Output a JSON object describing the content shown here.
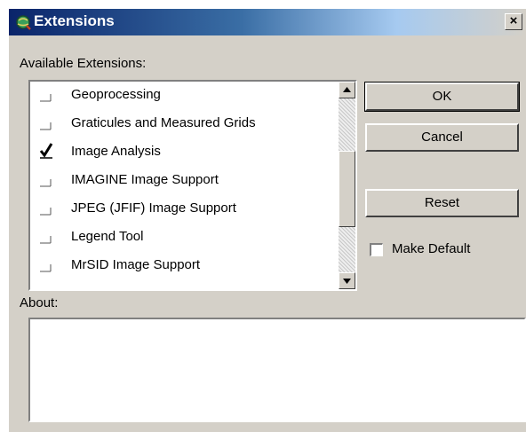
{
  "window": {
    "title": "Extensions",
    "close_glyph": "×"
  },
  "labels": {
    "available": "Available Extensions:",
    "about": "About:"
  },
  "extensions": [
    {
      "label": "Geoprocessing",
      "checked": false
    },
    {
      "label": "Graticules and Measured Grids",
      "checked": false
    },
    {
      "label": "Image Analysis",
      "checked": true
    },
    {
      "label": "IMAGINE Image Support",
      "checked": false
    },
    {
      "label": "JPEG (JFIF) Image Support",
      "checked": false
    },
    {
      "label": "Legend Tool",
      "checked": false
    },
    {
      "label": "MrSID Image Support",
      "checked": false
    }
  ],
  "buttons": {
    "ok": "OK",
    "cancel": "Cancel",
    "reset": "Reset"
  },
  "make_default": {
    "label": "Make Default",
    "checked": false
  },
  "about_text": "",
  "icons": {
    "app": "app-globe-icon",
    "check": "checkmark-icon",
    "scroll_up": "scroll-up-icon",
    "scroll_down": "scroll-down-icon"
  }
}
